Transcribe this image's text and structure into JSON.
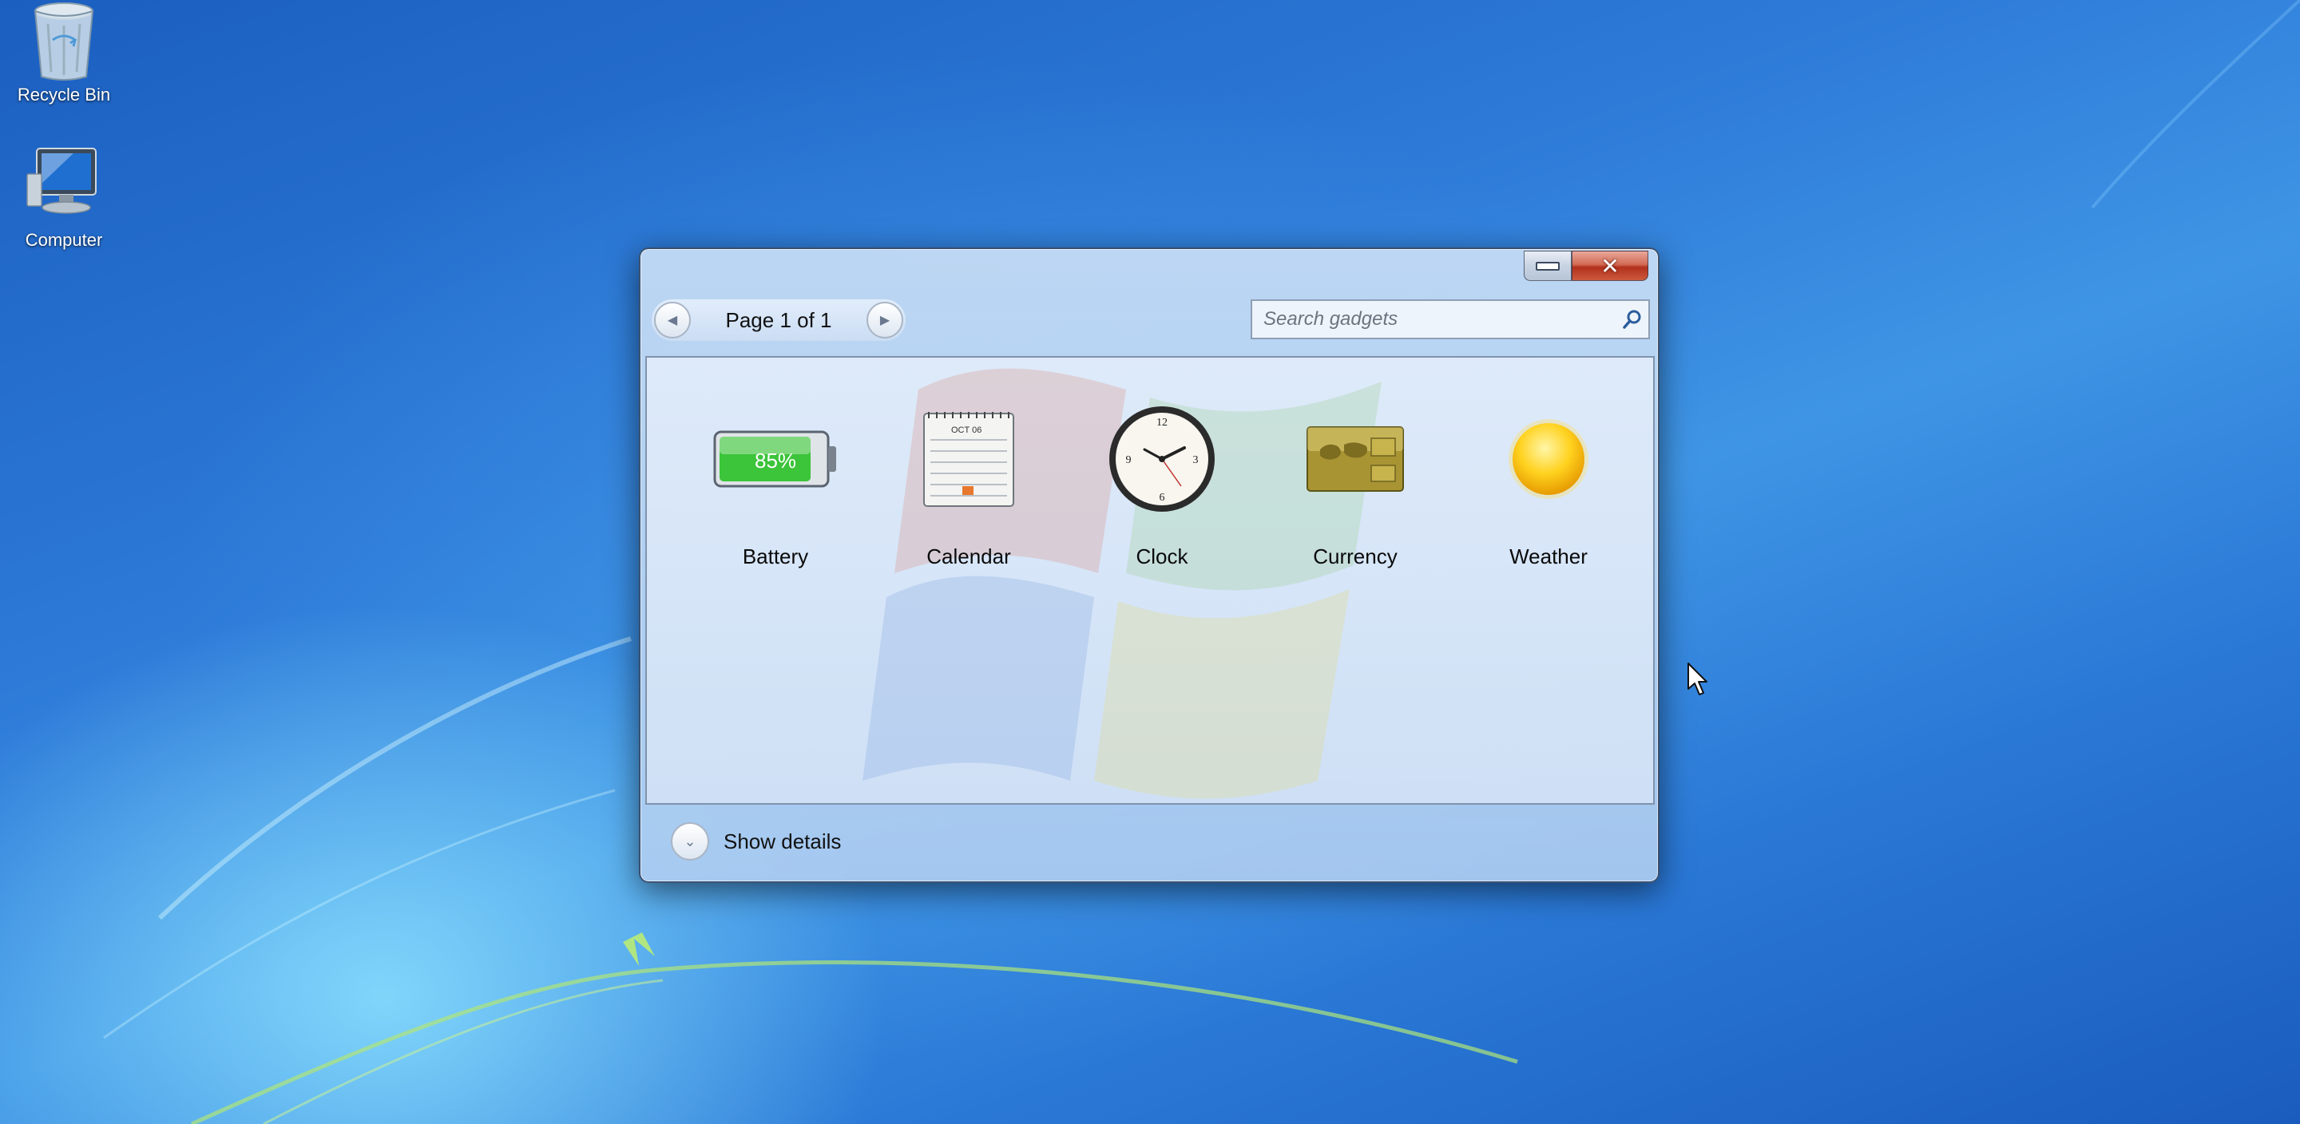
{
  "desktop": {
    "icons": [
      {
        "label": "Recycle Bin",
        "icon": "recycle-bin-icon"
      },
      {
        "label": "Computer",
        "icon": "computer-icon"
      }
    ]
  },
  "gadget_window": {
    "pager": {
      "label": "Page 1 of 1",
      "prev_icon": "chevron-left-icon",
      "next_icon": "chevron-right-icon"
    },
    "search": {
      "placeholder": "Search gadgets",
      "value": "",
      "icon": "search-icon"
    },
    "gadgets": [
      {
        "name": "Battery",
        "icon": "battery-icon",
        "level_label": "85%"
      },
      {
        "name": "Calendar",
        "icon": "calendar-icon",
        "month_label": "OCT 06"
      },
      {
        "name": "Clock",
        "icon": "clock-icon"
      },
      {
        "name": "Currency",
        "icon": "currency-icon"
      },
      {
        "name": "Weather",
        "icon": "weather-sun-icon"
      }
    ],
    "footer": {
      "label": "Show details",
      "icon": "chevron-down-icon"
    }
  },
  "colors": {
    "accent": "#2d7ad8",
    "close": "#c0442a"
  }
}
